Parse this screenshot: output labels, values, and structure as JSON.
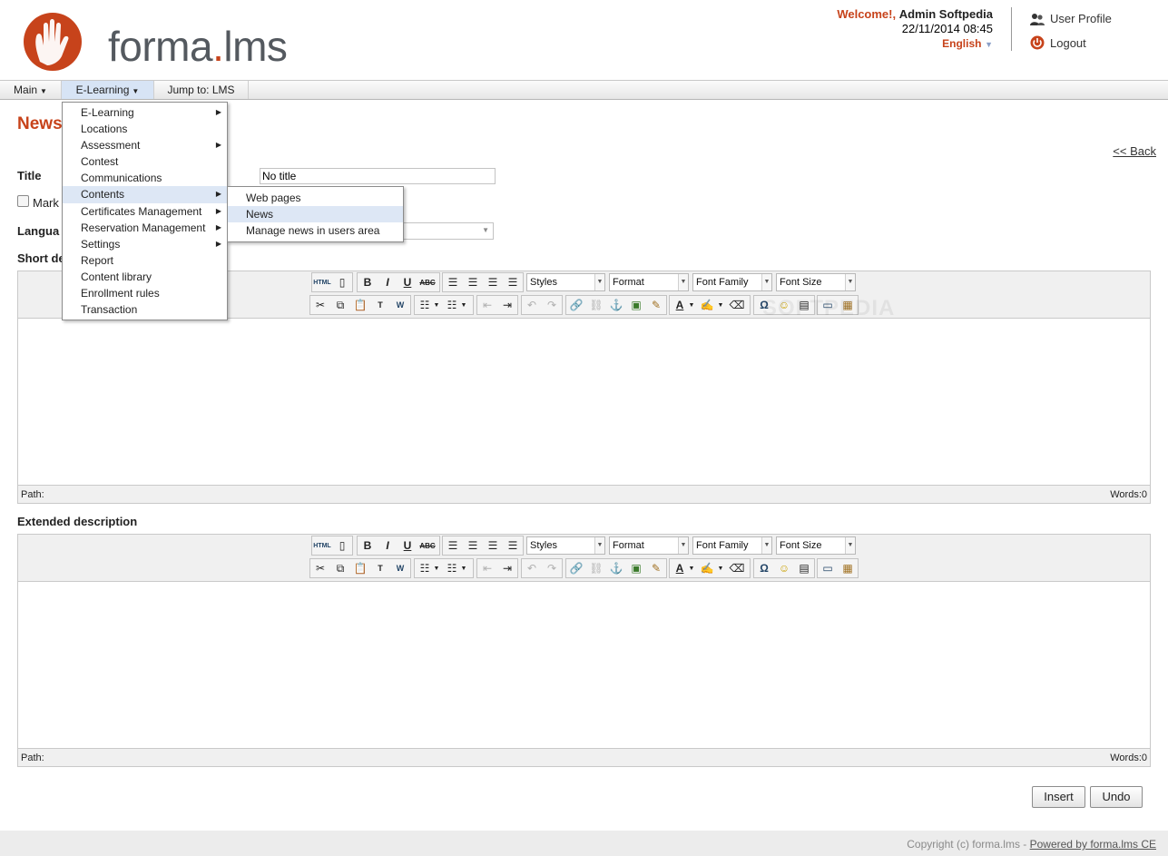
{
  "brand": {
    "logo_text": "forma",
    "logo_dot": ".",
    "logo_suffix": "lms",
    "brand_color": "#c7431b"
  },
  "header": {
    "welcome": "Welcome!,",
    "user": "Admin Softpedia",
    "datetime": "22/11/2014 08:45",
    "language": "English",
    "user_profile": "User Profile",
    "logout": "Logout"
  },
  "menubar": {
    "main": "Main",
    "elearning": "E-Learning",
    "jump": "Jump to: LMS"
  },
  "dropdown": {
    "items": [
      {
        "label": "E-Learning",
        "has_sub": true
      },
      {
        "label": "Locations",
        "has_sub": false
      },
      {
        "label": "Assessment",
        "has_sub": true
      },
      {
        "label": "Contest",
        "has_sub": false
      },
      {
        "label": "Communications",
        "has_sub": false
      },
      {
        "label": "Contents",
        "has_sub": true,
        "highlighted": true
      },
      {
        "label": "Certificates Management",
        "has_sub": true
      },
      {
        "label": "Reservation Management",
        "has_sub": true
      },
      {
        "label": "Settings",
        "has_sub": true
      },
      {
        "label": "Report",
        "has_sub": false
      },
      {
        "label": "Content library",
        "has_sub": false
      },
      {
        "label": "Enrollment rules",
        "has_sub": false
      },
      {
        "label": "Transaction",
        "has_sub": false
      }
    ],
    "submenu": [
      {
        "label": "Web pages"
      },
      {
        "label": "News",
        "highlighted": true
      },
      {
        "label": "Manage news in users area"
      }
    ]
  },
  "page": {
    "title": "News",
    "back": "<< Back",
    "title_label": "Title",
    "title_value": "No title",
    "mark_label": "Mark",
    "language_label": "Langua",
    "short_desc_label": "Short de",
    "extended_desc_label": "Extended description"
  },
  "editor": {
    "styles": "Styles",
    "format": "Format",
    "font_family": "Font Family",
    "font_size": "Font Size",
    "path": "Path:",
    "words": "Words:0"
  },
  "watermark": "SOFTPEDIA",
  "actions": {
    "insert": "Insert",
    "undo": "Undo"
  },
  "footer": {
    "copyright": "Copyright (c) forma.lms - ",
    "powered": "Powered by forma.lms CE"
  }
}
